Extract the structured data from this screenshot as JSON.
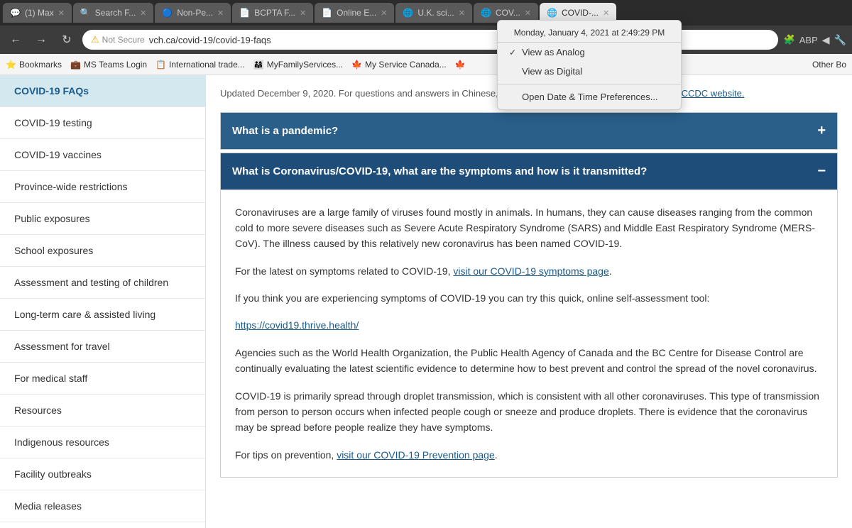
{
  "browser": {
    "tabs": [
      {
        "id": "tab1",
        "icon": "💬",
        "title": "(1) Max",
        "active": false,
        "closable": true
      },
      {
        "id": "tab2",
        "icon": "🔍",
        "title": "Search F...",
        "active": false,
        "closable": true
      },
      {
        "id": "tab3",
        "icon": "🔵",
        "title": "Non-Pe...",
        "active": false,
        "closable": true
      },
      {
        "id": "tab4",
        "icon": "📄",
        "title": "BCPTA F...",
        "active": false,
        "closable": true
      },
      {
        "id": "tab5",
        "icon": "📄",
        "title": "Online E...",
        "active": false,
        "closable": true
      },
      {
        "id": "tab6",
        "icon": "🌐",
        "title": "U.K. sci...",
        "active": false,
        "closable": true
      },
      {
        "id": "tab7",
        "icon": "🌐",
        "title": "COV...",
        "active": false,
        "closable": true
      },
      {
        "id": "tab8",
        "icon": "🌐",
        "title": "COVID-...",
        "active": true,
        "closable": true
      }
    ],
    "address": {
      "not_secure_label": "Not Secure",
      "url": "vch.ca/covid-19/covid-19-faqs"
    },
    "bookmarks": [
      {
        "icon": "⭐",
        "label": "Bookmarks"
      },
      {
        "icon": "💼",
        "label": "MS Teams Login"
      },
      {
        "icon": "📋",
        "label": "International trade..."
      },
      {
        "icon": "👨‍👩‍👧",
        "label": "MyFamilyServices..."
      },
      {
        "icon": "🍁",
        "label": "My Service Canada..."
      },
      {
        "icon": "🍁",
        "label": ""
      }
    ],
    "other_label": "Other Bo"
  },
  "dropdown": {
    "header": "Monday, January 4, 2021 at 2:49:29 PM",
    "items": [
      {
        "id": "analog",
        "label": "View as Analog",
        "checked": true
      },
      {
        "id": "digital",
        "label": "View as Digital",
        "checked": false
      },
      {
        "id": "prefs",
        "label": "Open Date & Time Preferences...",
        "separator_before": true
      }
    ]
  },
  "sidebar": {
    "items": [
      {
        "id": "faqs",
        "label": "COVID-19 FAQs",
        "active": true
      },
      {
        "id": "testing",
        "label": "COVID-19 testing",
        "active": false
      },
      {
        "id": "vaccines",
        "label": "COVID-19 vaccines",
        "active": false
      },
      {
        "id": "restrictions",
        "label": "Province-wide restrictions",
        "active": false
      },
      {
        "id": "public",
        "label": "Public exposures",
        "active": false
      },
      {
        "id": "school",
        "label": "School exposures",
        "active": false
      },
      {
        "id": "assessment-children",
        "label": "Assessment and testing of children",
        "active": false
      },
      {
        "id": "longterm",
        "label": "Long-term care & assisted living",
        "active": false
      },
      {
        "id": "travel",
        "label": "Assessment for travel",
        "active": false
      },
      {
        "id": "medical",
        "label": "For medical staff",
        "active": false
      },
      {
        "id": "resources",
        "label": "Resources",
        "active": false
      },
      {
        "id": "indigenous",
        "label": "Indigenous resources",
        "active": false
      },
      {
        "id": "outbreaks",
        "label": "Facility outbreaks",
        "active": false
      },
      {
        "id": "media",
        "label": "Media releases",
        "active": false
      }
    ]
  },
  "content": {
    "update_text": "Updated December 9, 2020. For questions and answers in Chinese, Punjabi, Farsi and French, please ",
    "update_link_text": "visit the BCCDC website.",
    "faqs": [
      {
        "id": "pandemic",
        "question": "What is a pandemic?",
        "expanded": false,
        "toggle_symbol": "+",
        "body": []
      },
      {
        "id": "coronavirus",
        "question": "What is Coronavirus/COVID-19, what are the symptoms and how is it transmitted?",
        "expanded": true,
        "toggle_symbol": "−",
        "paragraphs": [
          "Coronaviruses are a large family of viruses found mostly in animals. In humans, they can cause diseases ranging from the common cold to more severe diseases such as Severe Acute Respiratory Syndrome (SARS) and Middle East Respiratory Syndrome (MERS-CoV). The illness caused by this relatively new coronavirus has been named COVID-19.",
          "For the latest on symptoms related to COVID-19, {visit our COVID-19 symptoms page}.",
          "If you think you are experiencing symptoms of COVID-19 you can try this quick, online self-assessment tool:",
          "{https://covid19.thrive.health/}",
          "Agencies such as the World Health Organization, the Public Health Agency of Canada and the BC Centre for Disease Control are continually evaluating the latest scientific evidence to determine how to best prevent and control the spread of the novel coronavirus.",
          "COVID-19 is primarily spread through droplet transmission, which is consistent with all other coronaviruses. This type of transmission from person to person occurs when infected people cough or sneeze and produce droplets. There is evidence that the coronavirus may be spread before people realize they have symptoms.",
          "For tips on prevention, {visit our COVID-19 Prevention page}."
        ]
      }
    ]
  }
}
